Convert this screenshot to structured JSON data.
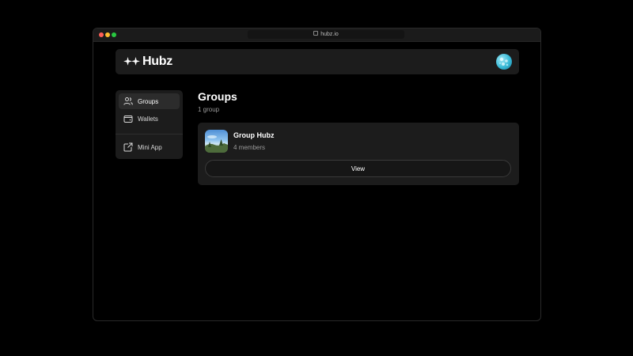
{
  "browser": {
    "url": "hubz.io",
    "lock_icon": "lock-icon"
  },
  "header": {
    "logo_text": "Hubz",
    "logo_icon": "sparkle-icon",
    "avatar_icon": "user-avatar"
  },
  "sidebar": {
    "items": [
      {
        "label": "Groups",
        "icon": "users-icon",
        "active": true
      },
      {
        "label": "Wallets",
        "icon": "wallet-icon",
        "active": false
      },
      {
        "label": "Mini App",
        "icon": "external-link-icon",
        "active": false
      }
    ]
  },
  "main": {
    "title": "Groups",
    "subtitle": "1 group",
    "groups": [
      {
        "name": "Group Hubz",
        "members": "4 members",
        "button_label": "View"
      }
    ]
  },
  "colors": {
    "background": "#000000",
    "card": "#1c1c1c",
    "active_item": "#2c2c2c",
    "text_primary": "#ffffff",
    "text_secondary": "#9a9a9a"
  }
}
